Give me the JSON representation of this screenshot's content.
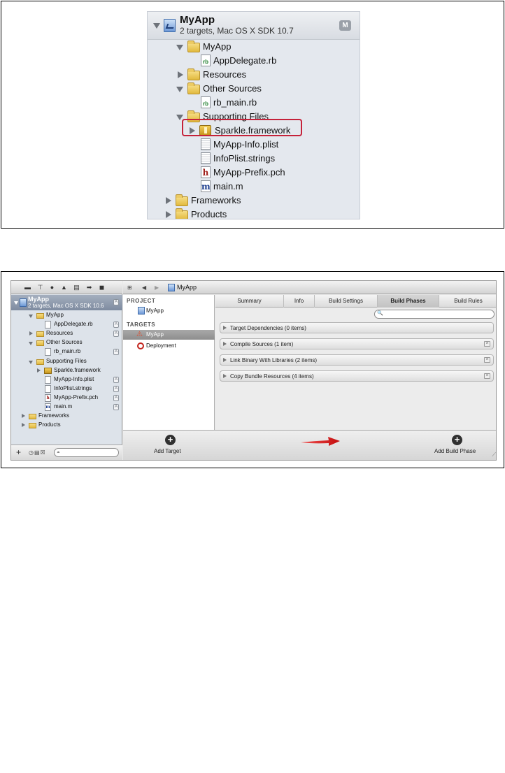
{
  "figure1": {
    "project": {
      "title": "MyApp",
      "subtitle": "2 targets, Mac OS X SDK 10.7",
      "badge": "M"
    },
    "items": [
      {
        "label": "MyApp",
        "icon": "folder",
        "disclosure": "open"
      },
      {
        "label": "AppDelegate.rb",
        "icon": "rb-file"
      },
      {
        "label": "Resources",
        "icon": "folder",
        "disclosure": "closed"
      },
      {
        "label": "Other Sources",
        "icon": "folder",
        "disclosure": "open"
      },
      {
        "label": "rb_main.rb",
        "icon": "rb-file"
      },
      {
        "label": "Supporting Files",
        "icon": "folder",
        "disclosure": "open"
      },
      {
        "label": "Sparkle.framework",
        "icon": "framework",
        "disclosure": "closed",
        "highlighted": true
      },
      {
        "label": "MyApp-Info.plist",
        "icon": "plist-file"
      },
      {
        "label": "InfoPlist.strings",
        "icon": "strings-file"
      },
      {
        "label": "MyApp-Prefix.pch",
        "icon": "h-file"
      },
      {
        "label": "main.m",
        "icon": "m-file"
      },
      {
        "label": "Frameworks",
        "icon": "folder",
        "disclosure": "closed"
      },
      {
        "label": "Products",
        "icon": "folder",
        "disclosure": "closed"
      }
    ],
    "file_icon_letters": {
      "rb": "rb",
      "h": "h",
      "m": "m"
    },
    "highlight_color": "#c5223a"
  },
  "figure2": {
    "navigator": {
      "project": {
        "title": "MyApp",
        "subtitle": "2 targets, Mac OS X SDK 10.6",
        "badge": "A"
      },
      "items": [
        {
          "label": "MyApp",
          "icon": "folder",
          "disclosure": "open"
        },
        {
          "label": "AppDelegate.rb",
          "icon": "rb-file",
          "badge": "A"
        },
        {
          "label": "Resources",
          "icon": "folder",
          "disclosure": "closed",
          "badge": "A"
        },
        {
          "label": "Other Sources",
          "icon": "folder",
          "disclosure": "open"
        },
        {
          "label": "rb_main.rb",
          "icon": "rb-file",
          "badge": "A"
        },
        {
          "label": "Supporting Files",
          "icon": "folder",
          "disclosure": "open"
        },
        {
          "label": "Sparkle.framework",
          "icon": "framework",
          "disclosure": "closed"
        },
        {
          "label": "MyApp-Info.plist",
          "icon": "plist-file",
          "badge": "A"
        },
        {
          "label": "InfoPlist.strings",
          "icon": "strings-file",
          "badge": "A"
        },
        {
          "label": "MyApp-Prefix.pch",
          "icon": "h-file",
          "badge": "A"
        },
        {
          "label": "main.m",
          "icon": "m-file",
          "badge": "A"
        },
        {
          "label": "Frameworks",
          "icon": "folder",
          "disclosure": "closed"
        },
        {
          "label": "Products",
          "icon": "folder",
          "disclosure": "closed"
        }
      ],
      "bottom": {
        "add": "+",
        "filters": "◷▤☒"
      }
    },
    "toolbar_icons": [
      "folder-icon",
      "hierarchy-icon",
      "search-icon",
      "warning-icon",
      "list-icon",
      "breakpoint-icon",
      "log-icon"
    ],
    "jumpbar": {
      "crumb": "MyApp",
      "grid": "⊞",
      "back": "◀",
      "forward": "▶"
    },
    "project_list": {
      "project_header": "PROJECT",
      "project_item": "MyApp",
      "targets_header": "TARGETS",
      "targets": [
        {
          "label": "MyApp",
          "selected": true,
          "icon": "app-icon"
        },
        {
          "label": "Deployment",
          "selected": false,
          "icon": "target-icon"
        }
      ]
    },
    "tabs": [
      {
        "label": "Summary",
        "active": false
      },
      {
        "label": "Info",
        "active": false
      },
      {
        "label": "Build Settings",
        "active": false
      },
      {
        "label": "Build Phases",
        "active": true
      },
      {
        "label": "Build Rules",
        "active": false
      }
    ],
    "search_placeholder": "",
    "phases": [
      {
        "label": "Target Dependencies (0 items)",
        "deletable": false
      },
      {
        "label": "Compile Sources (1 item)",
        "deletable": true
      },
      {
        "label": "Link Binary With Libraries (2 items)",
        "deletable": true
      },
      {
        "label": "Copy Bundle Resources (4 items)",
        "deletable": true
      }
    ],
    "bottom": {
      "add_target": "Add Target",
      "add_build_phase": "Add Build Phase",
      "plus": "+"
    },
    "arrow_color": "#e01b1b"
  }
}
